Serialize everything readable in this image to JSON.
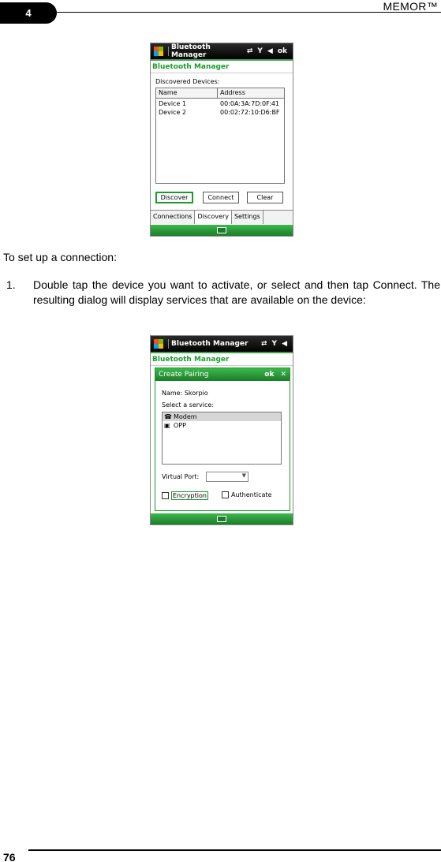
{
  "header": {
    "chapter": "4",
    "title": "MEMOR™"
  },
  "footer": {
    "page_number": "76"
  },
  "text": {
    "intro": "To set up a connection:",
    "step1_num": "1.",
    "step1_text": "Double tap the device you want to activate, or select and then tap Connect. The resulting dialog will display services that are available on the device:"
  },
  "screen1": {
    "title": "Bluetooth Manager",
    "ok": "ok",
    "app_title": "Bluetooth Manager",
    "discovered_label": "Discovered Devices:",
    "columns": [
      "Name",
      "Address"
    ],
    "rows": [
      {
        "name": "Device 1",
        "address": "00:0A:3A:7D:0F:41"
      },
      {
        "name": "Device 2",
        "address": "00:02:72:10:D6:BF"
      }
    ],
    "buttons": [
      "Discover",
      "Connect",
      "Clear"
    ],
    "tabs": [
      "Connections",
      "Discovery",
      "Settings"
    ]
  },
  "screen2": {
    "title": "Bluetooth Manager",
    "app_title": "Bluetooth Manager",
    "dialog": {
      "title": "Create Pairing",
      "ok": "ok",
      "close": "✕",
      "name_label": "Name:  Skorpio",
      "service_label": "Select a service:",
      "services": [
        "Modem",
        "OPP"
      ],
      "port_label": "Virtual Port:",
      "encryption": "Encryption",
      "authenticate": "Authenticate"
    }
  },
  "colors": {
    "accent_green": "#1c9a2c",
    "titlebar": "#000000"
  },
  "icons": [
    "windows-logo-icon",
    "connectivity-icon",
    "signal-icon",
    "volume-icon",
    "keyboard-icon",
    "modem-icon",
    "opp-icon",
    "chevron-down-icon"
  ]
}
